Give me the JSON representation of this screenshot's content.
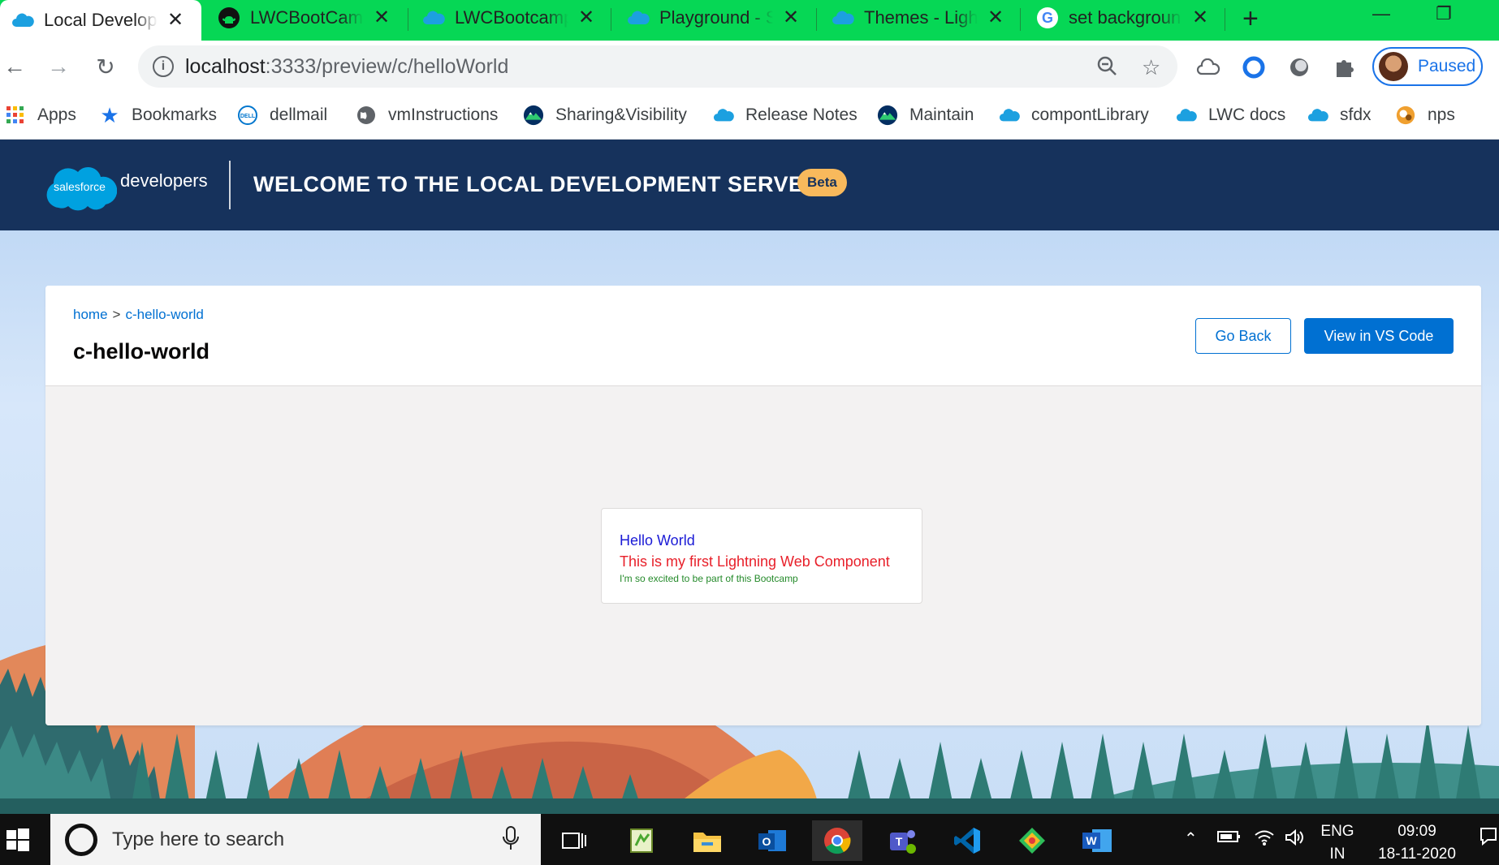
{
  "browser": {
    "tabs": [
      {
        "title": "Local Developm",
        "icon": "salesforce-cloud-icon",
        "active": true
      },
      {
        "title": "LWCBootCamp",
        "icon": "github-icon",
        "active": false
      },
      {
        "title": "LWCBootcamp",
        "icon": "salesforce-cloud-icon",
        "active": false
      },
      {
        "title": "Playground - S",
        "icon": "salesforce-cloud-icon",
        "active": false
      },
      {
        "title": "Themes - Light",
        "icon": "salesforce-cloud-icon",
        "active": false
      },
      {
        "title": "set backgroun",
        "icon": "google-icon",
        "active": false
      }
    ],
    "close_glyph": "✕",
    "new_tab_glyph": "+",
    "url_host": "localhost",
    "url_rest": ":3333/preview/c/helloWorld",
    "profile_label": "Paused",
    "bookmarks": [
      {
        "label": "Apps",
        "icon": "apps-grid-icon"
      },
      {
        "label": "Bookmarks",
        "icon": "star-icon"
      },
      {
        "label": "dellmail",
        "icon": "dell-icon"
      },
      {
        "label": "vmInstructions",
        "icon": "globe-icon"
      },
      {
        "label": "Sharing&Visibility",
        "icon": "trailhead-icon"
      },
      {
        "label": "Release Notes",
        "icon": "salesforce-cloud-icon"
      },
      {
        "label": "Maintain",
        "icon": "trailhead-icon"
      },
      {
        "label": "compontLibrary",
        "icon": "salesforce-cloud-icon"
      },
      {
        "label": "LWC docs",
        "icon": "salesforce-cloud-icon"
      },
      {
        "label": "sfdx",
        "icon": "salesforce-cloud-icon"
      },
      {
        "label": "nps",
        "icon": "nps-icon"
      }
    ]
  },
  "header": {
    "logo_text": "salesforce",
    "developers": "developers",
    "title": "WELCOME TO THE LOCAL DEVELOPMENT SERVER",
    "badge": "Beta"
  },
  "card": {
    "breadcrumb_home": "home",
    "breadcrumb_sep": ">",
    "breadcrumb_current": "c-hello-world",
    "title": "c-hello-world",
    "go_back": "Go Back",
    "view_vscode": "View in VS Code"
  },
  "component": {
    "line1": "Hello World",
    "line2": "This is my first Lightning Web Component",
    "line3": "I'm so excited to be part of this Bootcamp"
  },
  "taskbar": {
    "search_placeholder": "Type here to search",
    "lang_top": "ENG",
    "lang_bottom": "IN",
    "time": "09:09",
    "date": "18-11-2020"
  },
  "colors": {
    "tabstrip": "#06d755",
    "sf_header": "#16325c",
    "brand_blue": "#0070d2",
    "beta_badge": "#f8b95c",
    "hello_blue": "#1b1bd6",
    "message_red": "#e8202a",
    "excited_green": "#248a2a"
  }
}
